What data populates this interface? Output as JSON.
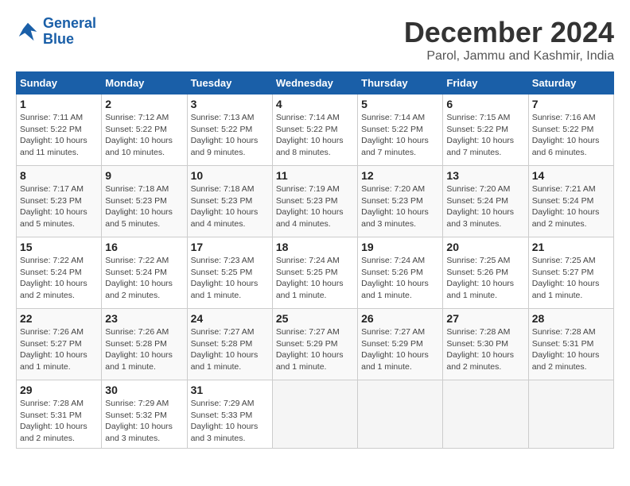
{
  "logo": {
    "line1": "General",
    "line2": "Blue"
  },
  "title": "December 2024",
  "subtitle": "Parol, Jammu and Kashmir, India",
  "days_of_week": [
    "Sunday",
    "Monday",
    "Tuesday",
    "Wednesday",
    "Thursday",
    "Friday",
    "Saturday"
  ],
  "weeks": [
    [
      {
        "day": "1",
        "info": "Sunrise: 7:11 AM\nSunset: 5:22 PM\nDaylight: 10 hours\nand 11 minutes."
      },
      {
        "day": "2",
        "info": "Sunrise: 7:12 AM\nSunset: 5:22 PM\nDaylight: 10 hours\nand 10 minutes."
      },
      {
        "day": "3",
        "info": "Sunrise: 7:13 AM\nSunset: 5:22 PM\nDaylight: 10 hours\nand 9 minutes."
      },
      {
        "day": "4",
        "info": "Sunrise: 7:14 AM\nSunset: 5:22 PM\nDaylight: 10 hours\nand 8 minutes."
      },
      {
        "day": "5",
        "info": "Sunrise: 7:14 AM\nSunset: 5:22 PM\nDaylight: 10 hours\nand 7 minutes."
      },
      {
        "day": "6",
        "info": "Sunrise: 7:15 AM\nSunset: 5:22 PM\nDaylight: 10 hours\nand 7 minutes."
      },
      {
        "day": "7",
        "info": "Sunrise: 7:16 AM\nSunset: 5:22 PM\nDaylight: 10 hours\nand 6 minutes."
      }
    ],
    [
      {
        "day": "8",
        "info": "Sunrise: 7:17 AM\nSunset: 5:23 PM\nDaylight: 10 hours\nand 5 minutes."
      },
      {
        "day": "9",
        "info": "Sunrise: 7:18 AM\nSunset: 5:23 PM\nDaylight: 10 hours\nand 5 minutes."
      },
      {
        "day": "10",
        "info": "Sunrise: 7:18 AM\nSunset: 5:23 PM\nDaylight: 10 hours\nand 4 minutes."
      },
      {
        "day": "11",
        "info": "Sunrise: 7:19 AM\nSunset: 5:23 PM\nDaylight: 10 hours\nand 4 minutes."
      },
      {
        "day": "12",
        "info": "Sunrise: 7:20 AM\nSunset: 5:23 PM\nDaylight: 10 hours\nand 3 minutes."
      },
      {
        "day": "13",
        "info": "Sunrise: 7:20 AM\nSunset: 5:24 PM\nDaylight: 10 hours\nand 3 minutes."
      },
      {
        "day": "14",
        "info": "Sunrise: 7:21 AM\nSunset: 5:24 PM\nDaylight: 10 hours\nand 2 minutes."
      }
    ],
    [
      {
        "day": "15",
        "info": "Sunrise: 7:22 AM\nSunset: 5:24 PM\nDaylight: 10 hours\nand 2 minutes."
      },
      {
        "day": "16",
        "info": "Sunrise: 7:22 AM\nSunset: 5:24 PM\nDaylight: 10 hours\nand 2 minutes."
      },
      {
        "day": "17",
        "info": "Sunrise: 7:23 AM\nSunset: 5:25 PM\nDaylight: 10 hours\nand 1 minute."
      },
      {
        "day": "18",
        "info": "Sunrise: 7:24 AM\nSunset: 5:25 PM\nDaylight: 10 hours\nand 1 minute."
      },
      {
        "day": "19",
        "info": "Sunrise: 7:24 AM\nSunset: 5:26 PM\nDaylight: 10 hours\nand 1 minute."
      },
      {
        "day": "20",
        "info": "Sunrise: 7:25 AM\nSunset: 5:26 PM\nDaylight: 10 hours\nand 1 minute."
      },
      {
        "day": "21",
        "info": "Sunrise: 7:25 AM\nSunset: 5:27 PM\nDaylight: 10 hours\nand 1 minute."
      }
    ],
    [
      {
        "day": "22",
        "info": "Sunrise: 7:26 AM\nSunset: 5:27 PM\nDaylight: 10 hours\nand 1 minute."
      },
      {
        "day": "23",
        "info": "Sunrise: 7:26 AM\nSunset: 5:28 PM\nDaylight: 10 hours\nand 1 minute."
      },
      {
        "day": "24",
        "info": "Sunrise: 7:27 AM\nSunset: 5:28 PM\nDaylight: 10 hours\nand 1 minute."
      },
      {
        "day": "25",
        "info": "Sunrise: 7:27 AM\nSunset: 5:29 PM\nDaylight: 10 hours\nand 1 minute."
      },
      {
        "day": "26",
        "info": "Sunrise: 7:27 AM\nSunset: 5:29 PM\nDaylight: 10 hours\nand 1 minute."
      },
      {
        "day": "27",
        "info": "Sunrise: 7:28 AM\nSunset: 5:30 PM\nDaylight: 10 hours\nand 2 minutes."
      },
      {
        "day": "28",
        "info": "Sunrise: 7:28 AM\nSunset: 5:31 PM\nDaylight: 10 hours\nand 2 minutes."
      }
    ],
    [
      {
        "day": "29",
        "info": "Sunrise: 7:28 AM\nSunset: 5:31 PM\nDaylight: 10 hours\nand 2 minutes."
      },
      {
        "day": "30",
        "info": "Sunrise: 7:29 AM\nSunset: 5:32 PM\nDaylight: 10 hours\nand 3 minutes."
      },
      {
        "day": "31",
        "info": "Sunrise: 7:29 AM\nSunset: 5:33 PM\nDaylight: 10 hours\nand 3 minutes."
      },
      null,
      null,
      null,
      null
    ]
  ]
}
